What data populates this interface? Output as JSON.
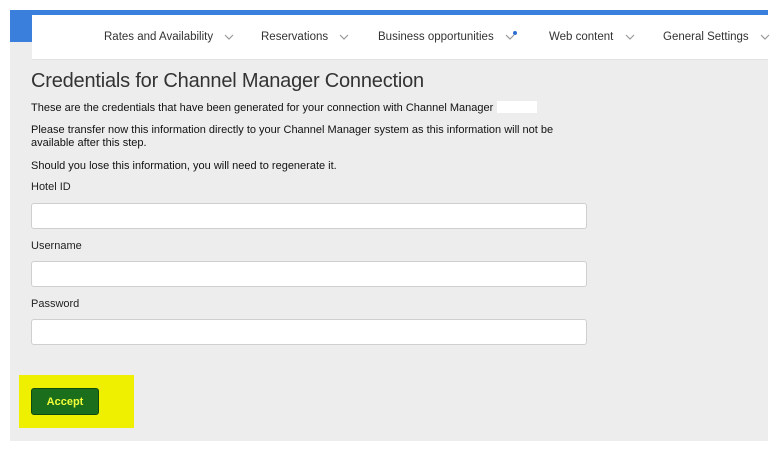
{
  "nav": {
    "items": [
      {
        "label": "Rates and Availability"
      },
      {
        "label": "Reservations"
      },
      {
        "label": "Business opportunities"
      },
      {
        "label": "Web content"
      },
      {
        "label": "General Settings"
      }
    ]
  },
  "page": {
    "title": "Credentials for Channel Manager Connection",
    "intro": "These are the credentials that have been generated for your connection with Channel Manager",
    "transfer_note": "Please transfer now this information directly to your Channel Manager system as this information will not be available after this step.",
    "regenerate_note": "Should you lose this information, you will need to regenerate it."
  },
  "form": {
    "hotel_id_label": "Hotel ID",
    "hotel_id_value": "",
    "username_label": "Username",
    "username_value": "",
    "password_label": "Password",
    "password_value": ""
  },
  "actions": {
    "accept_label": "Accept"
  },
  "colors": {
    "accent_blue": "#3b7fdc",
    "accept_button": "#1b6e1b",
    "accept_text": "#f2ff3a",
    "highlight": "#eef000",
    "panel_background": "#ededed"
  }
}
